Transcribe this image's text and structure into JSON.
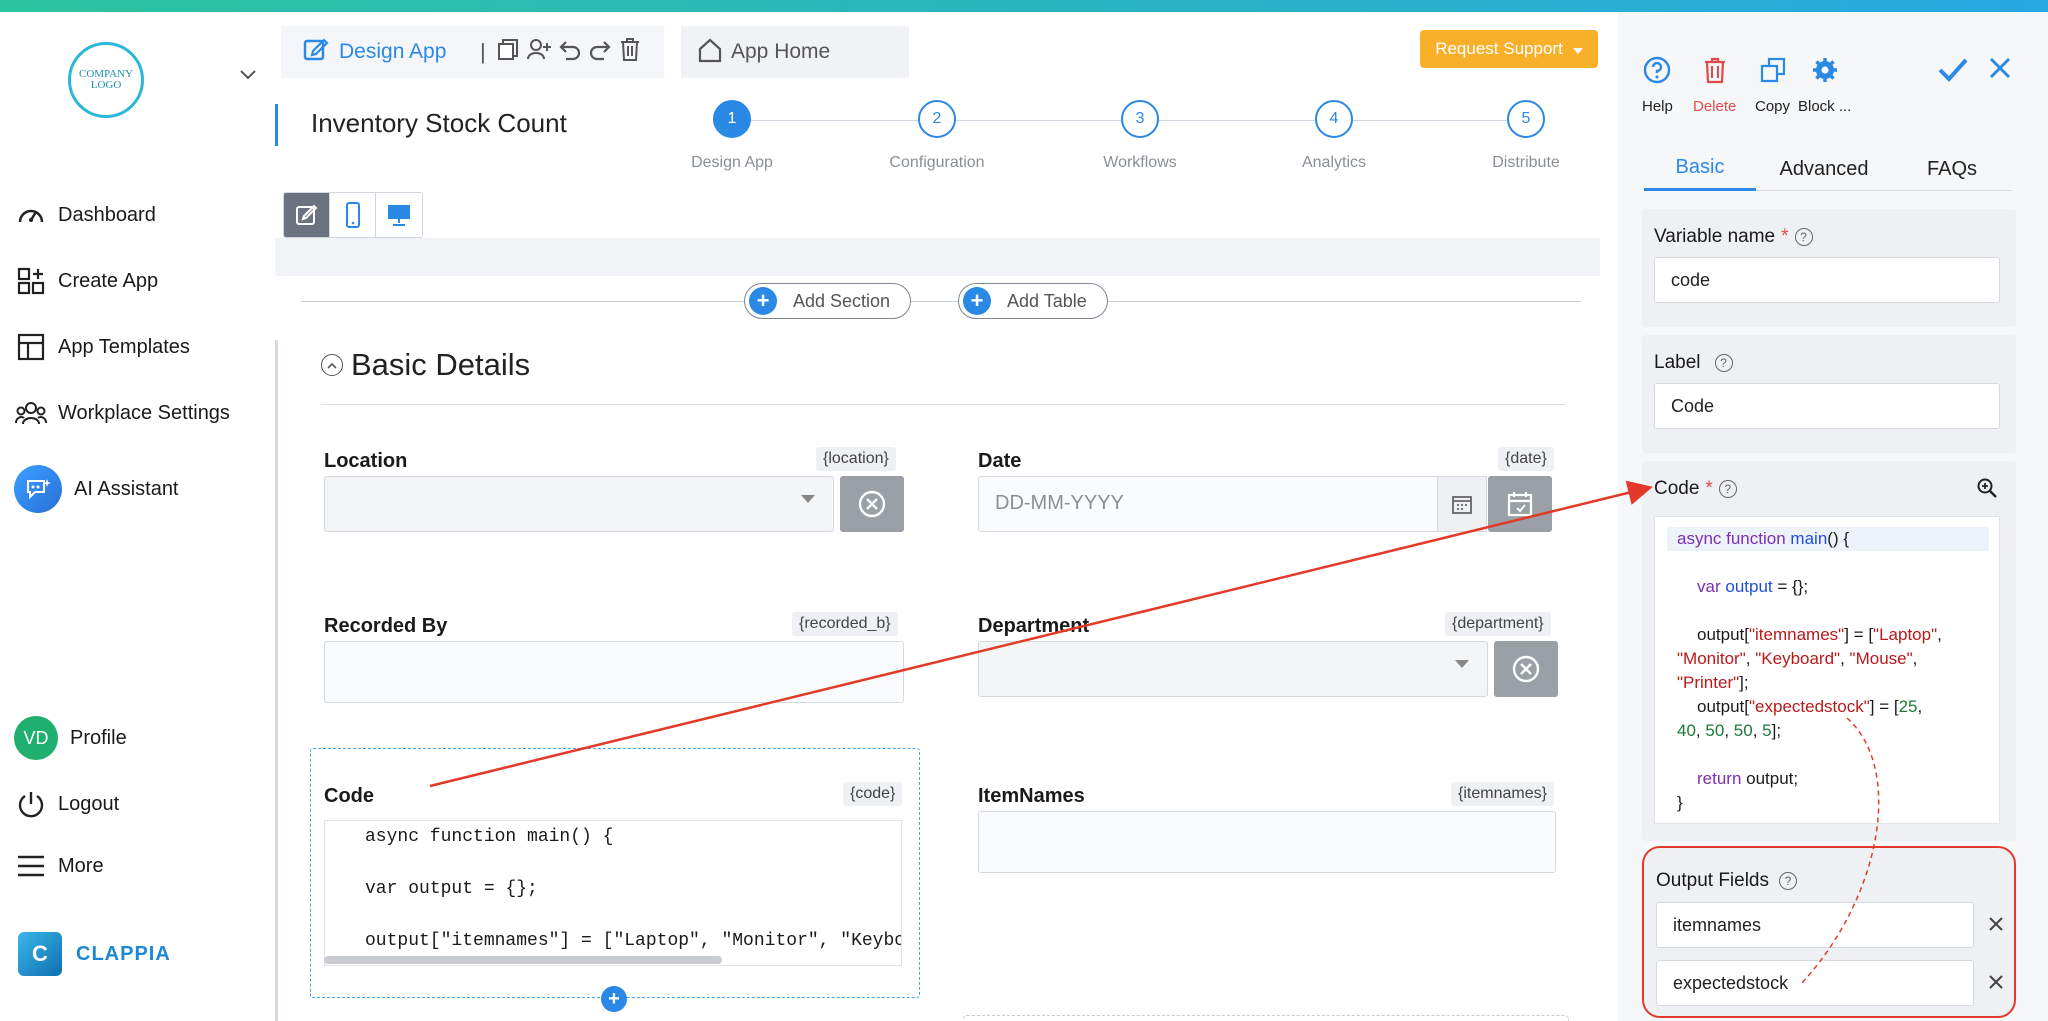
{
  "sidebar": {
    "logo_text_1": "COMPANY",
    "logo_text_2": "LOGO",
    "nav": [
      {
        "label": "Dashboard"
      },
      {
        "label": "Create App"
      },
      {
        "label": "App Templates"
      },
      {
        "label": "Workplace Settings"
      },
      {
        "label": "AI Assistant"
      }
    ],
    "profile_initials": "VD",
    "profile_label": "Profile",
    "logout_label": "Logout",
    "more_label": "More",
    "brand": "CLAPPIA"
  },
  "header": {
    "design_tab": "Design App",
    "separator": "|",
    "home_tab": "App Home",
    "request_support": "Request Support",
    "app_title": "Inventory Stock Count"
  },
  "stepper": [
    {
      "num": "1",
      "label": "Design App"
    },
    {
      "num": "2",
      "label": "Configuration"
    },
    {
      "num": "3",
      "label": "Workflows"
    },
    {
      "num": "4",
      "label": "Analytics"
    },
    {
      "num": "5",
      "label": "Distribute"
    }
  ],
  "canvas": {
    "add_section": "Add Section",
    "add_table": "Add Table",
    "section_title": "Basic Details",
    "fields": {
      "location": {
        "label": "Location",
        "tag": "{location}"
      },
      "date": {
        "label": "Date",
        "tag": "{date}",
        "placeholder": "DD-MM-YYYY"
      },
      "recorded_by": {
        "label": "Recorded By",
        "tag": "{recorded_b}"
      },
      "department": {
        "label": "Department",
        "tag": "{department}"
      },
      "code": {
        "label": "Code",
        "tag": "{code}"
      },
      "itemnames": {
        "label": "ItemNames",
        "tag": "{itemnames}"
      }
    },
    "code_preview": [
      "async function main() {",
      "var output = {};",
      "output[\"itemnames\"] = [\"Laptop\", \"Monitor\", \"Keyboa"
    ]
  },
  "right_panel": {
    "tools": [
      {
        "label": "Help"
      },
      {
        "label": "Delete"
      },
      {
        "label": "Copy"
      },
      {
        "label": "Block ..."
      }
    ],
    "tabs": [
      {
        "label": "Basic"
      },
      {
        "label": "Advanced"
      },
      {
        "label": "FAQs"
      }
    ],
    "variable_name_label": "Variable name",
    "variable_name_value": "code",
    "label_label": "Label",
    "label_value": "Code",
    "code_label": "Code",
    "required_mark": "*",
    "output_fields_label": "Output Fields",
    "outputs": [
      "itemnames",
      "expectedstock"
    ],
    "code_tokens": {
      "async_function": "async function",
      "main": "main",
      "open": "() {",
      "var": "var",
      "output_var": "output",
      "assign_empty": " = {};",
      "output": "output[",
      "k_itemnames": "\"itemnames\"",
      "close_assign": "] = [",
      "laptop": "\"Laptop\"",
      "comma": ",",
      "monitor": "\"Monitor\"",
      "keyboard": "\"Keyboard\"",
      "mouse": "\"Mouse\"",
      "printer": "\"Printer\"",
      "end": "];",
      "k_expectedstock": "\"expectedstock\"",
      "n25": "25",
      "n40": "40",
      "n50": "50",
      "n5": "5",
      "return": "return",
      "return_tail": " output;",
      "close_brace": "}"
    }
  },
  "colors": {
    "accent": "#2b89e6",
    "request_support": "#f8b02a",
    "annotation": "#e23a2a"
  }
}
